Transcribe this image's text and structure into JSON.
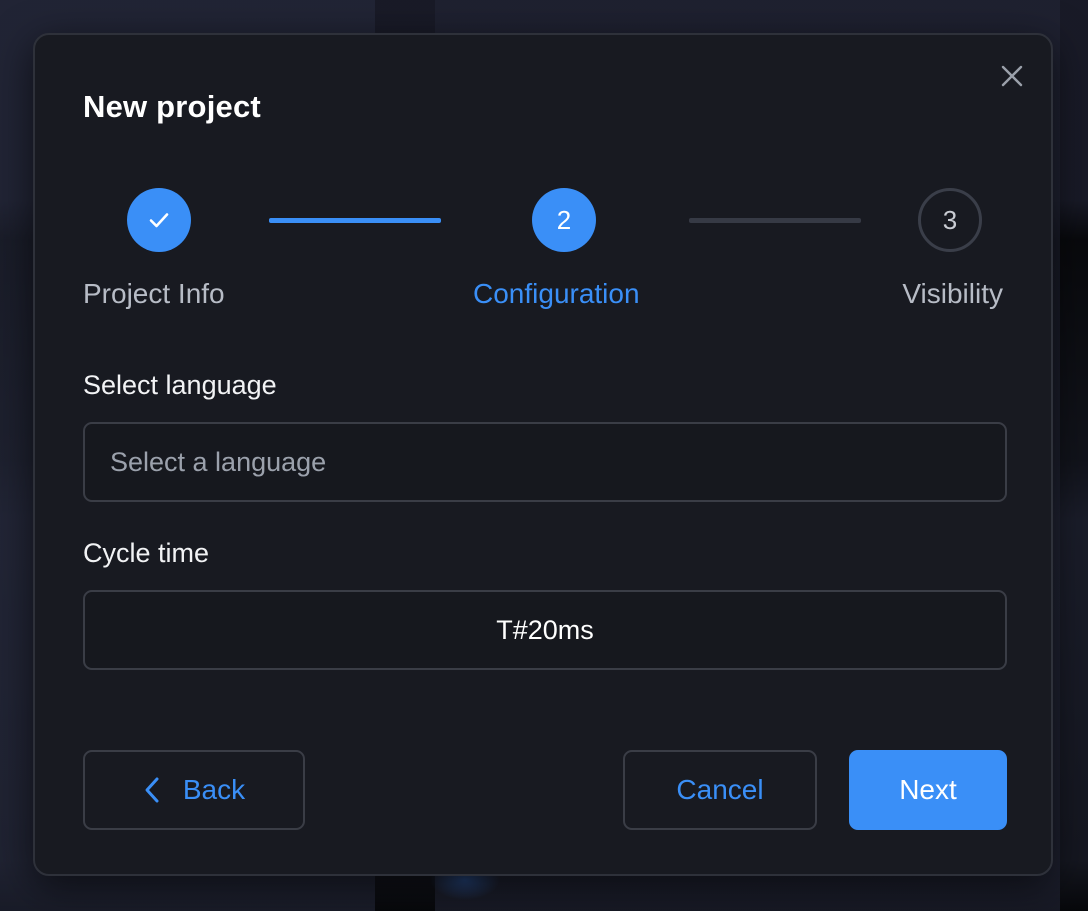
{
  "dialog": {
    "title": "New project",
    "close_icon": "close-icon"
  },
  "stepper": {
    "steps": [
      {
        "number": "",
        "label": "Project Info",
        "state": "completed",
        "icon": "checkmark-icon"
      },
      {
        "number": "2",
        "label": "Configuration",
        "state": "active"
      },
      {
        "number": "3",
        "label": "Visibility",
        "state": "pending"
      }
    ]
  },
  "form": {
    "language": {
      "label": "Select language",
      "placeholder": "Select a language"
    },
    "cycle_time": {
      "label": "Cycle time",
      "value": "T#20ms"
    }
  },
  "actions": {
    "back_label": "Back",
    "back_icon": "chevron-left-icon",
    "cancel_label": "Cancel",
    "next_label": "Next"
  },
  "colors": {
    "accent": "#3a8ff7",
    "modal_background": "#181a21",
    "border": "#3a3d46"
  }
}
